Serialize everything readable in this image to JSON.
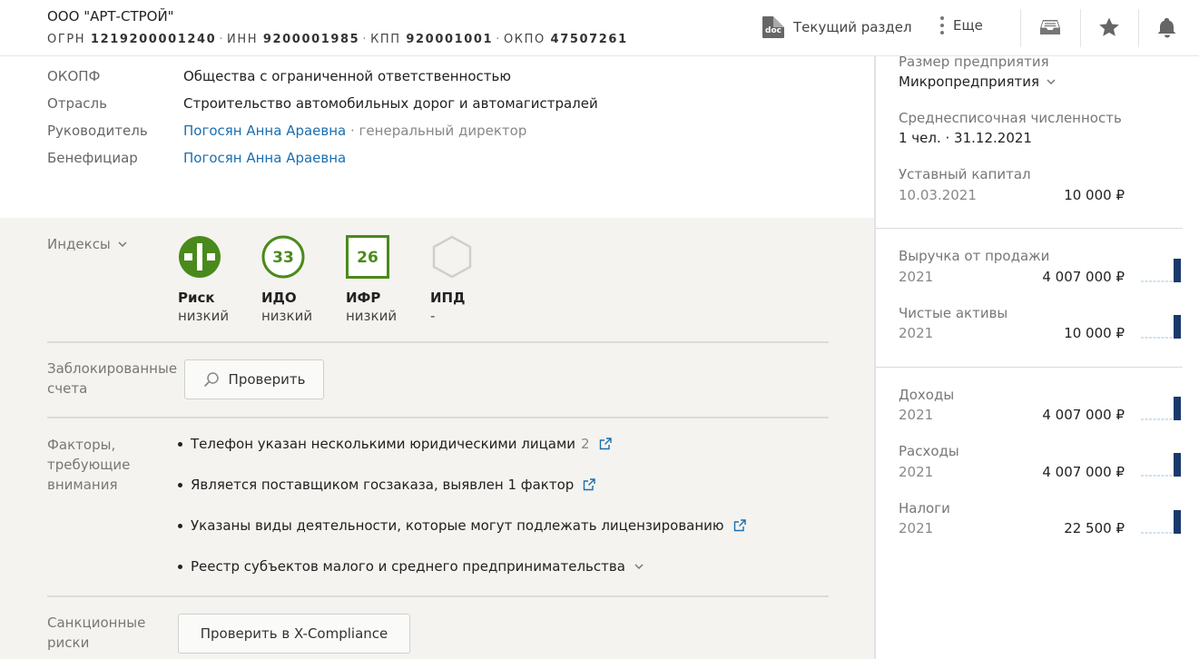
{
  "header": {
    "company_name": "ООО \"АРТ-СТРОЙ\"",
    "ids": [
      {
        "label": "ОГРН",
        "value": "1219200001240"
      },
      {
        "label": "ИНН",
        "value": "9200001985"
      },
      {
        "label": "КПП",
        "value": "920001001"
      },
      {
        "label": "ОКПО",
        "value": "47507261"
      }
    ],
    "current_section_label": "Текущий раздел",
    "doc_icon_text": "doc",
    "more_label": "Еще"
  },
  "details": {
    "okopf_label": "ОКОПФ",
    "okopf_value": "Общества с ограниченной ответственностью",
    "industry_label": "Отрасль",
    "industry_value": "Строительство автомобильных дорог и автомагистралей",
    "head_label": "Руководитель",
    "head_name": "Погосян Анна Араевна",
    "head_position": " · генеральный директор",
    "beneficiary_label": "Бенефициар",
    "beneficiary_name": "Погосян Анна Араевна"
  },
  "indices": {
    "label": "Индексы",
    "items": [
      {
        "name": "Риск",
        "level": "низкий",
        "badge": ""
      },
      {
        "name": "ИДО",
        "level": "низкий",
        "badge": "33"
      },
      {
        "name": "ИФР",
        "level": "низкий",
        "badge": "26"
      },
      {
        "name": "ИПД",
        "level": "-",
        "badge": ""
      }
    ],
    "accent_color": "#4a8a1c"
  },
  "blocked_accounts": {
    "label_line1": "Заблокированные",
    "label_line2": "счета",
    "button": "Проверить"
  },
  "factors": {
    "label_line1": "Факторы,",
    "label_line2": "требующие",
    "label_line3": "внимания",
    "items": [
      {
        "text": "Телефон указан несколькими юридическими лицами",
        "count": "2"
      },
      {
        "text": "Является поставщиком госзаказа, выявлен 1 фактор"
      },
      {
        "text": "Указаны виды деятельности, которые могут подлежать лицензированию"
      },
      {
        "text": "Реестр субъектов малого и среднего предпринимательства"
      }
    ]
  },
  "sanctions": {
    "label_line1": "Санкционные",
    "label_line2": "риски",
    "button": "Проверить в X-Compliance"
  },
  "sidebar": {
    "size_label": "Размер предприятия",
    "size_value": "Микропредприятия",
    "headcount_label": "Среднесписочная численность",
    "headcount_value": "1 чел. · 31.12.2021",
    "capital_label": "Уставный капитал",
    "capital_date": "10.03.2021",
    "capital_value": "10 000 ₽",
    "finance": [
      {
        "label": "Выручка от продажи",
        "year": "2021",
        "value": "4 007 000 ₽"
      },
      {
        "label": "Чистые активы",
        "year": "2021",
        "value": "10 000 ₽"
      }
    ],
    "tax": [
      {
        "label": "Доходы",
        "year": "2021",
        "value": "4 007 000 ₽"
      },
      {
        "label": "Расходы",
        "year": "2021",
        "value": "4 007 000 ₽"
      },
      {
        "label": "Налоги",
        "year": "2021",
        "value": "22 500 ₽"
      }
    ],
    "bar_color": "#1a3a6b",
    "dash_color": "#9fc3e3"
  }
}
